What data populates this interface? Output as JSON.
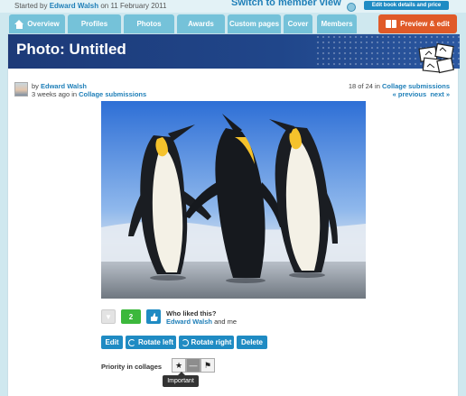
{
  "topbar": {
    "started_prefix": "Started by",
    "started_by": "Edward Walsh",
    "started_suffix": "on 11 February 2011",
    "switch_view": "Switch to member view",
    "edit_book": "Edit book details and price"
  },
  "tabs": [
    {
      "label": "Overview",
      "icon": "house-icon"
    },
    {
      "label": "Profiles"
    },
    {
      "label": "Photos"
    },
    {
      "label": "Awards"
    },
    {
      "label": "Custom pages"
    },
    {
      "label": "Cover"
    },
    {
      "label": "Members"
    }
  ],
  "preview": {
    "label": "Preview & edit",
    "icon": "book-icon"
  },
  "colors": {
    "accent": "#1f8bc3",
    "header": "#1d3a78",
    "preview": "#e05a28",
    "like": "#3cb83c"
  },
  "page": {
    "title": "Photo: Untitled"
  },
  "author": {
    "by": "by",
    "name": "Edward Walsh",
    "time": "3 weeks ago in",
    "album": "Collage submissions"
  },
  "nav": {
    "position": "18 of 24 in",
    "album": "Collage submissions",
    "previous": "« previous",
    "next": "next »"
  },
  "photo": {
    "subject": "king penguins"
  },
  "likes": {
    "count": "2",
    "who_title": "Who liked this?",
    "who_name": "Edward Walsh",
    "who_suffix": "and me"
  },
  "actions": {
    "edit": "Edit",
    "rotate_left": "Rotate left",
    "rotate_right": "Rotate right",
    "delete": "Delete"
  },
  "priority": {
    "label": "Priority in collages",
    "star": "★",
    "neutral": "—",
    "flag": "⚑",
    "tooltip": "Important"
  }
}
